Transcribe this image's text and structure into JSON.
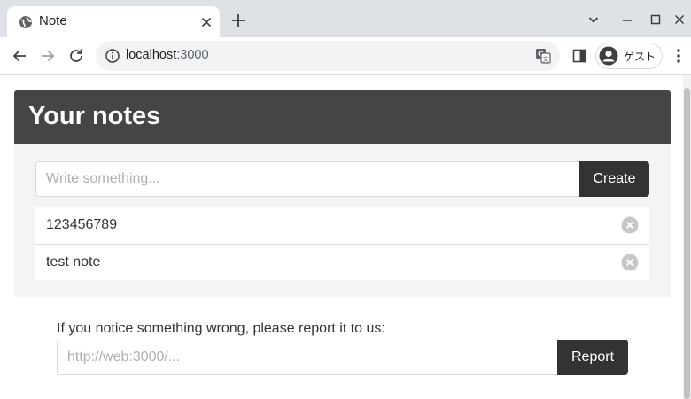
{
  "browser": {
    "tab": {
      "title": "Note",
      "favicon": "globe-icon"
    },
    "address_bar": {
      "host": "localhost",
      "port": ":3000"
    },
    "profile": {
      "label": "ゲスト"
    }
  },
  "notes_app": {
    "title": "Your notes",
    "new_note": {
      "placeholder": "Write something...",
      "value": ""
    },
    "create_label": "Create",
    "notes": [
      {
        "text": "123456789"
      },
      {
        "text": "test note"
      }
    ]
  },
  "report": {
    "label": "If you notice something wrong, please report it to us:",
    "input": {
      "placeholder": "http://web:3000/...",
      "value": ""
    },
    "button_label": "Report"
  },
  "colors": {
    "header_bg": "#454545",
    "button_bg": "#333333",
    "card_bg": "#f4f4f4",
    "tabstrip_bg": "#dee1e6"
  }
}
